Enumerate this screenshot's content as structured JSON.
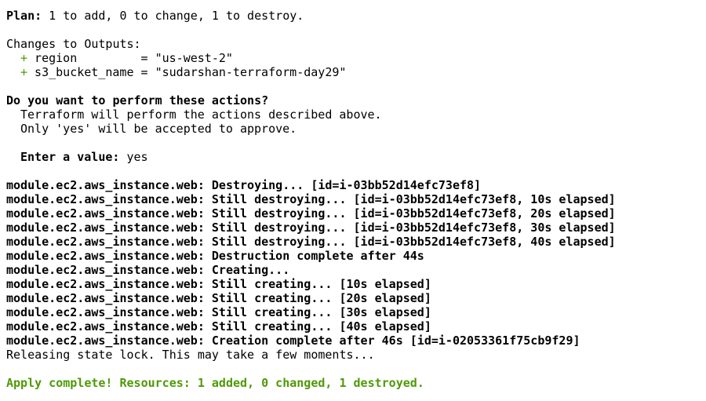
{
  "plan": {
    "label": "Plan:",
    "summary": " 1 to add, 0 to change, 1 to destroy."
  },
  "outputs": {
    "header": "Changes to Outputs:",
    "items": [
      {
        "sign": "+",
        "text": " region         = \"us-west-2\""
      },
      {
        "sign": "+",
        "text": " s3_bucket_name = \"sudarshan-terraform-day29\""
      }
    ]
  },
  "prompt": {
    "question": "Do you want to perform these actions?",
    "line1": "Terraform will perform the actions described above.",
    "line2": "Only 'yes' will be accepted to approve.",
    "enter_label": "Enter a value:",
    "enter_value": " yes"
  },
  "log": [
    {
      "resource": "module.ec2.aws_instance.web:",
      "message": " Destroying... [id=i-03bb52d14efc73ef8]"
    },
    {
      "resource": "module.ec2.aws_instance.web:",
      "message": " Still destroying... [id=i-03bb52d14efc73ef8, 10s elapsed]"
    },
    {
      "resource": "module.ec2.aws_instance.web:",
      "message": " Still destroying... [id=i-03bb52d14efc73ef8, 20s elapsed]"
    },
    {
      "resource": "module.ec2.aws_instance.web:",
      "message": " Still destroying... [id=i-03bb52d14efc73ef8, 30s elapsed]"
    },
    {
      "resource": "module.ec2.aws_instance.web:",
      "message": " Still destroying... [id=i-03bb52d14efc73ef8, 40s elapsed]"
    },
    {
      "resource": "module.ec2.aws_instance.web:",
      "message": " Destruction complete after 44s"
    },
    {
      "resource": "module.ec2.aws_instance.web:",
      "message": " Creating..."
    },
    {
      "resource": "module.ec2.aws_instance.web:",
      "message": " Still creating... [10s elapsed]"
    },
    {
      "resource": "module.ec2.aws_instance.web:",
      "message": " Still creating... [20s elapsed]"
    },
    {
      "resource": "module.ec2.aws_instance.web:",
      "message": " Still creating... [30s elapsed]"
    },
    {
      "resource": "module.ec2.aws_instance.web:",
      "message": " Still creating... [40s elapsed]"
    },
    {
      "resource": "module.ec2.aws_instance.web:",
      "message": " Creation complete after 46s [id=i-02053361f75cb9f29]"
    }
  ],
  "releasing": "Releasing state lock. This may take a few moments...",
  "apply_complete": "Apply complete! Resources: 1 added, 0 changed, 1 destroyed.",
  "colors": {
    "background": "#ffffff",
    "text": "#000000",
    "success": "#4e9a06"
  }
}
